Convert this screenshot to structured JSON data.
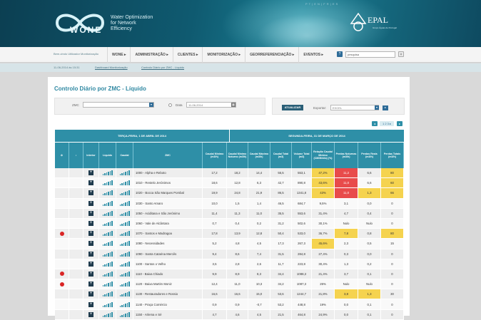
{
  "header": {
    "toplink": "P T | E N | F R | E S",
    "app_name": "WONE",
    "tagline": [
      "Water Optimization",
      "for Network",
      "Efficiency"
    ],
    "brand": "EPAL",
    "brand_sub": "Grupo Águas de Portugal"
  },
  "nav": {
    "welcome": "Bem-vindo Utilizador Monitorização",
    "items": [
      "WONE ▸",
      "ADMINISTRAÇÃO ▸",
      "CLIENTES ▸",
      "MONITORIZAÇÃO ▸",
      "GEORREFERENCIAÇÃO ▸",
      "EVENTOS ▸"
    ],
    "search_value": "pesquisa",
    "datetime": "11-06-2014 às 15:31",
    "breadcrumb": [
      "Dashboard Monitorização",
      "Controlo Diário por ZMC - Líquido"
    ]
  },
  "page": {
    "title": "Controlo Diário por ZMC - Líquido",
    "zmc_label": "ZMC",
    "data_label": "Data",
    "data_value": "11-06-2014",
    "export_button": "ATUALIZAR",
    "exportar_label": "Exportar:",
    "exportar_value": "EXCEL",
    "pager": [
      "◂",
      "1 2 3 ▸",
      "▸"
    ]
  },
  "colors": {
    "accent": "#2e8fa7",
    "alert": "#d92525",
    "warn_red": "#e84b4b",
    "warn_yellow": "#f5d34f",
    "warn_orange": "#f7b544"
  },
  "table": {
    "group_headers": [
      "TERÇA-FEIRA, 1 DE ABRIL DE 2014",
      "SEGUNDA-FEIRA, 31 DE MARÇO DE 2014"
    ],
    "columns": [
      "",
      "",
      "Interior",
      "Líquido",
      "Caudal",
      "ZMC",
      "Caudal Mínimo (m3/h)",
      "Caudal Mínimo Noturno (m3/h)",
      "Caudal Máximo (m3/h)",
      "Caudal Total (m3)",
      "Volume Total (m3)",
      "Relação Caudal Mínimo (CM/Médio) (%)",
      "Perdas Noturnas (m3/h)",
      "Perdas Reais (m3/h)",
      "Perdas Totais (m3/h)"
    ],
    "rows": [
      {
        "alert": false,
        "zmc": "1000 - Alpha e Reboto",
        "v": [
          "17,2",
          "18,2",
          "14,4",
          "55,5",
          "553,1",
          "47,2%",
          "11,2",
          "6,6",
          "80"
        ],
        "hl": [
          "",
          "",
          "",
          "",
          "",
          "yel",
          "red",
          "",
          "yel"
        ]
      },
      {
        "alert": false,
        "zmc": "1010 - Restelo Jerónimos",
        "v": [
          "18,6",
          "12,8",
          "6,3",
          "42,7",
          "890,8",
          "43,6%",
          "11,0",
          "6,6",
          "60"
        ],
        "hl": [
          "",
          "",
          "",
          "",
          "",
          "yel",
          "red",
          "",
          "yel"
        ]
      },
      {
        "alert": false,
        "zmc": "1020 - Bocca São Marques Pombal",
        "v": [
          "19,9",
          "24,8",
          "21,9",
          "86,5",
          "1341,8",
          "43%",
          "11,0",
          "1,3",
          "66"
        ],
        "hl": [
          "",
          "",
          "",
          "",
          "",
          "yel",
          "red",
          "yel",
          "yel"
        ]
      },
      {
        "alert": false,
        "zmc": "1030 - Santo Amaro",
        "v": [
          "10,0",
          "1,5",
          "1,4",
          "46,5",
          "684,7",
          "9,5%",
          "3,1",
          "0,0",
          "0"
        ],
        "hl": [
          "",
          "",
          "",
          "",
          "",
          "",
          "",
          "",
          ""
        ]
      },
      {
        "alert": false,
        "zmc": "1050 - Aciditana e São Jerónimo",
        "v": [
          "11,4",
          "11,3",
          "11,0",
          "35,5",
          "553,6",
          "31,4%",
          "4,7",
          "0,4",
          "0"
        ],
        "hl": [
          "",
          "",
          "",
          "",
          "",
          "",
          "",
          "",
          ""
        ]
      },
      {
        "alert": false,
        "zmc": "1060 - Vale de Alcântara",
        "v": [
          "0,7",
          "0,4",
          "0,2",
          "31,2",
          "502,6",
          "30,1%",
          "Nulo",
          "Nulo",
          "0"
        ],
        "hl": [
          "",
          "",
          "",
          "",
          "",
          "",
          "",
          "",
          ""
        ]
      },
      {
        "alert": true,
        "zmc": "1070 - Santos e Madragoa",
        "v": [
          "17,8",
          "13,9",
          "12,8",
          "50,4",
          "533,0",
          "36,7%",
          "7,8",
          "0,8",
          "80"
        ],
        "hl": [
          "",
          "",
          "",
          "",
          "",
          "",
          "yel",
          "",
          "yel"
        ]
      },
      {
        "alert": false,
        "zmc": "1080 - Necessidades",
        "v": [
          "5,2",
          "4,8",
          "4,5",
          "17,3",
          "267,3",
          "45,6%",
          "2,3",
          "0,5",
          "15"
        ],
        "hl": [
          "",
          "",
          "",
          "",
          "",
          "yel",
          "",
          "",
          ""
        ]
      },
      {
        "alert": false,
        "zmc": "1090 - Santa Catarina Mercês",
        "v": [
          "9,4",
          "8,6",
          "7,4",
          "31,5",
          "284,8",
          "27,4%",
          "0,3",
          "0,0",
          "0"
        ],
        "hl": [
          "",
          "",
          "",
          "",
          "",
          "",
          "",
          "",
          ""
        ]
      },
      {
        "alert": false,
        "zmc": "1100 - Santos o Velho",
        "v": [
          "3,5",
          "2,8",
          "2,6",
          "11,7",
          "223,8",
          "30,4%",
          "1,3",
          "0,2",
          "0"
        ],
        "hl": [
          "",
          "",
          "",
          "",
          "",
          "",
          "",
          "",
          ""
        ]
      },
      {
        "alert": true,
        "zmc": "1110 - Baixa Chiado",
        "v": [
          "9,9",
          "8,9",
          "8,3",
          "34,4",
          "1088,3",
          "21,4%",
          "3,7",
          "0,1",
          "0"
        ],
        "hl": [
          "",
          "",
          "",
          "",
          "",
          "",
          "",
          "",
          ""
        ]
      },
      {
        "alert": true,
        "zmc": "1120 - Baixa Martim Moniz",
        "v": [
          "12,4",
          "11,0",
          "10,3",
          "34,2",
          "1087,3",
          "25%",
          "Nulo",
          "Nulo",
          "0"
        ],
        "hl": [
          "",
          "",
          "",
          "",
          "",
          "",
          "",
          "",
          ""
        ]
      },
      {
        "alert": false,
        "zmc": "1130 - Restauradores e Rossio",
        "v": [
          "16,6",
          "16,6",
          "15,0",
          "53,6",
          "1244,7",
          "21,8%",
          "3,8",
          "1,3",
          "30"
        ],
        "hl": [
          "",
          "",
          "",
          "",
          "",
          "",
          "yel",
          "yel",
          ""
        ]
      },
      {
        "alert": false,
        "zmc": "1140 - Praça Comércio",
        "v": [
          "0,9",
          "0,9",
          "-0,7",
          "53,2",
          "448,8",
          "19%",
          "0,0",
          "0,1",
          "0"
        ],
        "hl": [
          "",
          "",
          "",
          "",
          "",
          "",
          "",
          "",
          ""
        ]
      },
      {
        "alert": false,
        "zmc": "1150 - Arlema e Sé",
        "v": [
          "4,7",
          "4,6",
          "4,5",
          "21,5",
          "464,8",
          "24,9%",
          "0,0",
          "0,1",
          "0"
        ],
        "hl": [
          "",
          "",
          "",
          "",
          "",
          "",
          "",
          "",
          ""
        ]
      }
    ]
  }
}
